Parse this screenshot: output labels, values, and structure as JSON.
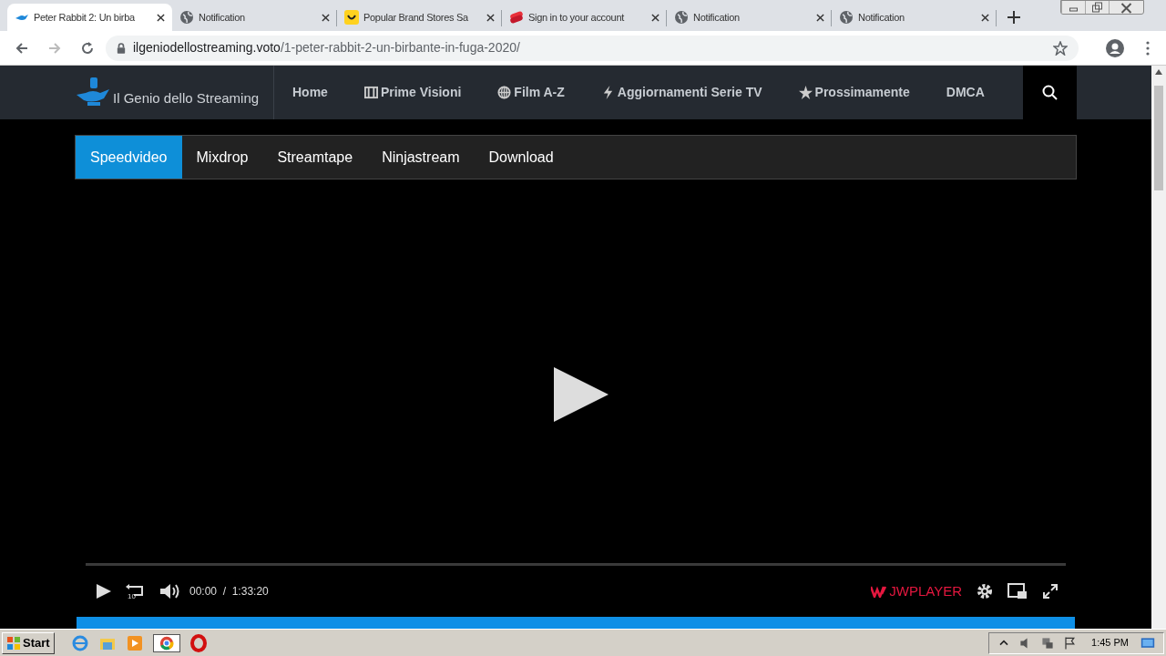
{
  "browser": {
    "tabs": [
      {
        "title": "Peter Rabbit 2: Un birba",
        "kind": "genie",
        "selected": true
      },
      {
        "title": "Notification",
        "kind": "globe",
        "selected": false
      },
      {
        "title": "Popular Brand Stores Sa",
        "kind": "smile",
        "selected": false
      },
      {
        "title": "Sign in to your account",
        "kind": "ribbon",
        "selected": false
      },
      {
        "title": "Notification",
        "kind": "globe",
        "selected": false
      },
      {
        "title": "Notification",
        "kind": "globe",
        "selected": false
      }
    ],
    "url_host": "ilgeniodellostreaming.voto",
    "url_path": "/1-peter-rabbit-2-un-birbante-in-fuga-2020/"
  },
  "site": {
    "logo": "Il Genio dello Streaming",
    "nav": [
      {
        "label": "Home",
        "kind": "plain"
      },
      {
        "label": "Prime Visioni",
        "kind": "film"
      },
      {
        "label": "Film A-Z",
        "kind": "globe"
      },
      {
        "label": "Aggiornamenti Serie TV",
        "kind": "bolt"
      },
      {
        "label": "Prossimamente",
        "kind": "star"
      },
      {
        "label": "DMCA",
        "kind": "plain"
      }
    ],
    "servers": [
      {
        "label": "Speedvideo",
        "selected": true
      },
      {
        "label": "Mixdrop",
        "selected": false
      },
      {
        "label": "Streamtape",
        "selected": false
      },
      {
        "label": "Ninjastream",
        "selected": false
      },
      {
        "label": "Download",
        "selected": false
      }
    ]
  },
  "player": {
    "time": "00:00",
    "separator": "/",
    "duration": "1:33:20",
    "brand": "JWPLAYER",
    "rewind_label": "10"
  },
  "taskbar": {
    "start": "Start",
    "clock": "1:45 PM"
  }
}
